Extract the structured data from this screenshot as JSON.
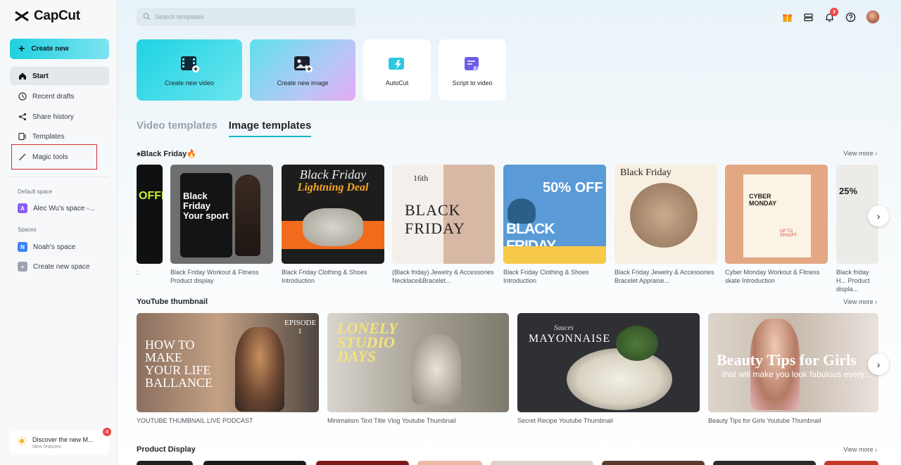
{
  "app": {
    "name": "CapCut"
  },
  "sidebar": {
    "create_new": "Create new",
    "nav": [
      {
        "label": "Start",
        "icon": "home-icon"
      },
      {
        "label": "Recent drafts",
        "icon": "clock-icon"
      },
      {
        "label": "Share history",
        "icon": "share-icon"
      },
      {
        "label": "Templates",
        "icon": "template-icon"
      },
      {
        "label": "Magic tools",
        "icon": "magic-wand-icon"
      }
    ],
    "default_space_label": "Default space",
    "default_space": {
      "badge": "A",
      "label": "Alec Wu's space -..."
    },
    "spaces_label": "Spaces",
    "spaces": [
      {
        "badge": "N",
        "label": "Noah's space"
      },
      {
        "badge": "+",
        "label": "Create new space"
      }
    ],
    "discover": {
      "title": "Discover the new M...",
      "subtitle": "New features",
      "badge": "4"
    }
  },
  "header": {
    "search_placeholder": "Search templates",
    "notification_count": "3"
  },
  "quick_actions": [
    {
      "label": "Create new video"
    },
    {
      "label": "Create new image"
    },
    {
      "label": "AutoCut"
    },
    {
      "label": "Script to video"
    }
  ],
  "tabs": [
    "Video templates",
    "Image templates"
  ],
  "view_more": "View more",
  "sections": {
    "black_friday": {
      "title": "♠Black Friday🔥",
      "items": [
        {
          "caption": ":",
          "text": "OFFER"
        },
        {
          "caption": "Black Friday Workout & Fitness Product display",
          "text": "Black Friday Your sport"
        },
        {
          "caption": "Black Friday Clothing & Shoes Introduction",
          "text": "Black Friday",
          "subtext": "Lightning Deal"
        },
        {
          "caption": "(Black friday)   Jewelry & Accessories Necklace&Bracelet...",
          "text": "BLACK FRIDAY",
          "subtext": "16th"
        },
        {
          "caption": "Black Friday Clothing & Shoes Introduction",
          "text": "BLACK FRIDAY",
          "subtext": "50% OFF"
        },
        {
          "caption": "Black Friday Jewelry & Accessories Bracelet Appraise...",
          "text": "Black Friday"
        },
        {
          "caption": "Cyber Monday Workout & Fitness skate Introduction",
          "text": "CYBER MONDAY",
          "subtext": "UP TO 55%OFF"
        },
        {
          "caption": "Black friday H... Product displa...",
          "text": "25%"
        }
      ]
    },
    "youtube": {
      "title": "YouTube thumbnail",
      "items": [
        {
          "caption": "YOUTUBE THUMBNAIL LIVE PODCAST",
          "text": "HOW TO MAKE YOUR LIFE BALLANCE",
          "subtext": "EPISODE 1"
        },
        {
          "caption": "Minimalism Text Title Vlog Youtube Thumbnail",
          "text": "LONELY STUDIO DAYS"
        },
        {
          "caption": "Secret Recipe Youtube Thumbnail",
          "text": "MAYONNAISE",
          "subtext": "Sauces"
        },
        {
          "caption": "Beauty Tips for Girls Youtube Thumbnail",
          "text": "Beauty Tips for Girls",
          "subtext": "that will make you look fabulous every..."
        }
      ]
    },
    "product_display": {
      "title": "Product Display"
    }
  }
}
